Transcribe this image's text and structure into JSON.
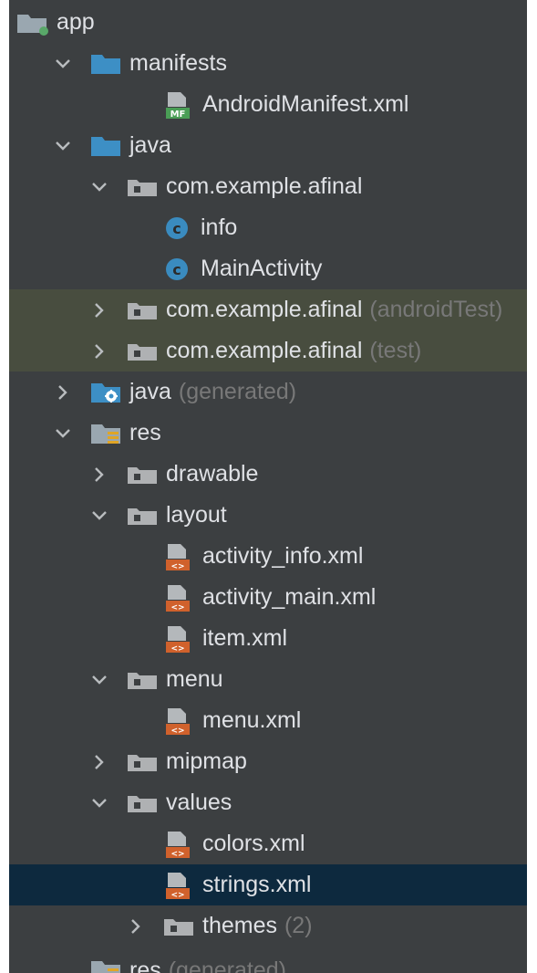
{
  "tree": [
    {
      "id": "app",
      "label": "app",
      "indent": 0,
      "arrow": "none",
      "icon": "module-folder-icon"
    },
    {
      "id": "manifests",
      "label": "manifests",
      "indent": 1,
      "arrow": "down",
      "icon": "folder-blue-icon"
    },
    {
      "id": "androidmanifest",
      "label": "AndroidManifest.xml",
      "indent": 3,
      "arrow": "none",
      "icon": "manifest-file-icon"
    },
    {
      "id": "java",
      "label": "java",
      "indent": 1,
      "arrow": "down",
      "icon": "folder-blue-icon"
    },
    {
      "id": "pkg-main",
      "label": "com.example.afinal",
      "indent": 2,
      "arrow": "down",
      "icon": "package-folder-icon"
    },
    {
      "id": "class-info",
      "label": "info",
      "indent": 3,
      "arrow": "none",
      "icon": "class-icon"
    },
    {
      "id": "class-mainactivity",
      "label": "MainActivity",
      "indent": 3,
      "arrow": "none",
      "icon": "class-icon"
    },
    {
      "id": "pkg-androidtest",
      "label": "com.example.afinal",
      "suffix": "(androidTest)",
      "indent": 2,
      "arrow": "right",
      "icon": "package-folder-icon",
      "test": true
    },
    {
      "id": "pkg-test",
      "label": "com.example.afinal",
      "suffix": "(test)",
      "indent": 2,
      "arrow": "right",
      "icon": "package-folder-icon",
      "test": true
    },
    {
      "id": "java-generated",
      "label": "java",
      "suffix": "(generated)",
      "indent": 1,
      "arrow": "right",
      "icon": "generated-folder-icon"
    },
    {
      "id": "res",
      "label": "res",
      "indent": 1,
      "arrow": "down",
      "icon": "resources-folder-icon"
    },
    {
      "id": "drawable",
      "label": "drawable",
      "indent": 2,
      "arrow": "right",
      "icon": "package-folder-icon"
    },
    {
      "id": "layout",
      "label": "layout",
      "indent": 2,
      "arrow": "down",
      "icon": "package-folder-icon"
    },
    {
      "id": "activity-info",
      "label": "activity_info.xml",
      "indent": 3,
      "arrow": "none",
      "icon": "xml-file-icon"
    },
    {
      "id": "activity-main",
      "label": "activity_main.xml",
      "indent": 3,
      "arrow": "none",
      "icon": "xml-file-icon"
    },
    {
      "id": "item-xml",
      "label": "item.xml",
      "indent": 3,
      "arrow": "none",
      "icon": "xml-file-icon"
    },
    {
      "id": "menu",
      "label": "menu",
      "indent": 2,
      "arrow": "down",
      "icon": "package-folder-icon"
    },
    {
      "id": "menu-xml",
      "label": "menu.xml",
      "indent": 3,
      "arrow": "none",
      "icon": "xml-file-icon"
    },
    {
      "id": "mipmap",
      "label": "mipmap",
      "indent": 2,
      "arrow": "right",
      "icon": "package-folder-icon"
    },
    {
      "id": "values",
      "label": "values",
      "indent": 2,
      "arrow": "down",
      "icon": "package-folder-icon"
    },
    {
      "id": "colors-xml",
      "label": "colors.xml",
      "indent": 3,
      "arrow": "none",
      "icon": "xml-file-icon"
    },
    {
      "id": "strings-xml",
      "label": "strings.xml",
      "indent": 3,
      "arrow": "none",
      "icon": "xml-file-icon",
      "selected": true
    },
    {
      "id": "themes",
      "label": "themes",
      "suffix": "(2)",
      "indent": 3,
      "arrow": "right",
      "icon": "package-folder-icon"
    },
    {
      "id": "res-generated",
      "label": "res",
      "suffix": "(generated)",
      "indent": 1,
      "arrow": "none",
      "icon": "resources-folder-icon",
      "partial": true
    }
  ],
  "colors": {
    "background": "#3c3f41",
    "text": "#dfe1e5",
    "muted_text": "#787878",
    "selection": "#0d293e",
    "test_highlight": "#484d3f",
    "folder_blue": "#3d8fc5",
    "class_circle": "#3a8bbf",
    "xml_orange": "#d0612c",
    "manifest_green": "#4a9e56",
    "module_dot": "#59a869"
  }
}
